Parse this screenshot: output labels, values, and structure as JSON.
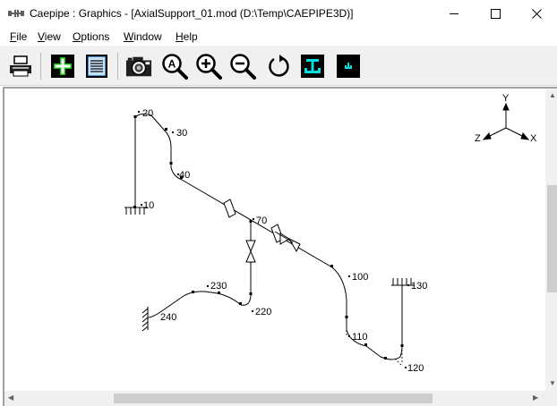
{
  "window": {
    "title": "Caepipe : Graphics -  [AxialSupport_01.mod (D:\\Temp\\CAEPIPE3D)]",
    "minimize_glyph": "—",
    "maximize_glyph": "☐",
    "close_glyph": "✕"
  },
  "menu": {
    "items": [
      {
        "mnemonic": "F",
        "rest": "ile"
      },
      {
        "mnemonic": "V",
        "rest": "iew"
      },
      {
        "mnemonic": "O",
        "rest": "ptions"
      },
      {
        "mnemonic": "W",
        "rest": "indow"
      },
      {
        "mnemonic": "H",
        "rest": "elp"
      }
    ]
  },
  "toolbar": {
    "buttons": [
      "print-icon",
      "plus-icon",
      "list-icon",
      "camera-icon",
      "zoom-auto-icon",
      "zoom-in-icon",
      "zoom-out-icon",
      "rotate-icon",
      "support-icon",
      "anchor-small-icon"
    ],
    "zoom_auto_letter": "A"
  },
  "model": {
    "nodes": [
      {
        "label": "10"
      },
      {
        "label": "20"
      },
      {
        "label": "30"
      },
      {
        "label": "40"
      },
      {
        "label": "70"
      },
      {
        "label": "100"
      },
      {
        "label": "110"
      },
      {
        "label": "120"
      },
      {
        "label": "130"
      },
      {
        "label": "220"
      },
      {
        "label": "230"
      },
      {
        "label": "240"
      }
    ],
    "axes": {
      "y": "Y",
      "z": "Z",
      "x": "X"
    }
  },
  "colors": {
    "icon_dark": "#000000",
    "icon_green": "#10c010",
    "icon_cyan": "#00e0e0",
    "icon_blue": "#1060c0"
  }
}
